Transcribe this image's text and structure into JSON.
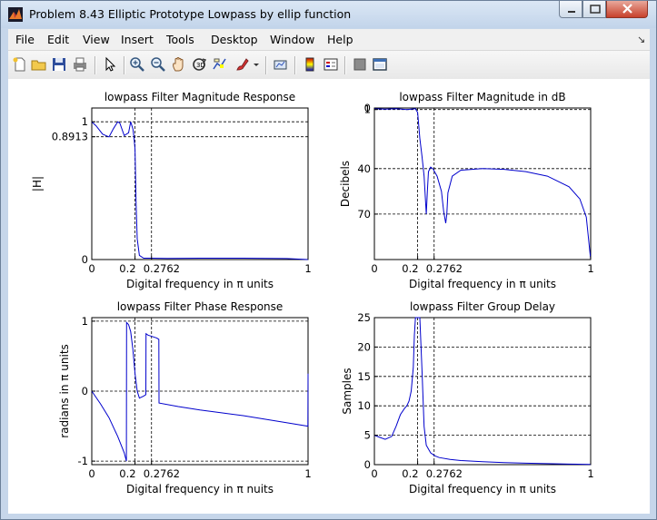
{
  "window": {
    "title": "Problem 8.43 Elliptic Prototype Lowpass by ellip function",
    "icon": "matlab-figure-icon"
  },
  "menu": [
    "File",
    "Edit",
    "View",
    "Insert",
    "Tools",
    "Desktop",
    "Window",
    "Help"
  ],
  "toolbar": [
    "new-figure-icon",
    "open-file-icon",
    "save-icon",
    "print-icon",
    "pointer-icon",
    "zoom-in-icon",
    "zoom-out-icon",
    "pan-icon",
    "rotate-3d-icon",
    "data-cursor-icon",
    "brush-icon",
    "link-plot-icon",
    "colorbar-icon",
    "legend-icon",
    "hide-plot-tools-icon",
    "show-plot-tools-icon"
  ],
  "colors": {
    "plot_line": "#0000cc",
    "axes": "#000000",
    "grid": "#000000",
    "window_frame": "#c6d6ea"
  },
  "chart_data": [
    {
      "type": "line",
      "title": "lowpass Filter Magnitude Response",
      "xlabel": "Digital frequency in π units",
      "ylabel": "|H|",
      "xlim": [
        0,
        1
      ],
      "ylim": [
        0,
        1.1
      ],
      "x_ticks": [
        "0",
        "0.2",
        "0.2762",
        "1"
      ],
      "x_tick_values": [
        0,
        0.2,
        0.2762,
        1
      ],
      "y_ticks": [
        "0",
        "0.8913",
        "1"
      ],
      "y_tick_values": [
        0,
        0.8913,
        1
      ],
      "grid": "dashed at ticks",
      "series": [
        {
          "x": [
            0,
            0.02,
            0.05,
            0.08,
            0.1,
            0.12,
            0.13,
            0.15,
            0.17,
            0.18,
            0.19,
            0.195,
            0.2,
            0.205,
            0.21,
            0.22,
            0.24,
            0.2762,
            0.35,
            0.5,
            0.7,
            0.9,
            1
          ],
          "y": [
            1,
            0.97,
            0.91,
            0.89,
            0.95,
            1,
            0.99,
            0.9,
            0.92,
            1,
            0.95,
            0.89,
            0.8,
            0.4,
            0.15,
            0.03,
            0.01,
            0.01,
            0.008,
            0.01,
            0.01,
            0.007,
            0.0
          ]
        }
      ]
    },
    {
      "type": "line",
      "title": "lowpass Filter Magnitude in dB",
      "xlabel": "Digital frequency in π units",
      "ylabel": "Decibels",
      "xlim": [
        0,
        1
      ],
      "ylim": [
        -100,
        0
      ],
      "y_reversed_labels": true,
      "x_ticks": [
        "0",
        "0.2",
        "0.2762",
        "1"
      ],
      "x_tick_values": [
        0,
        0.2,
        0.2762,
        1
      ],
      "y_ticks": [
        "1",
        "0",
        "40",
        "70"
      ],
      "y_tick_values": [
        -1,
        0,
        -40,
        -70
      ],
      "grid": "dashed at ticks",
      "series": [
        {
          "x": [
            0,
            0.05,
            0.1,
            0.15,
            0.19,
            0.2,
            0.21,
            0.22,
            0.23,
            0.24,
            0.245,
            0.25,
            0.26,
            0.27,
            0.29,
            0.31,
            0.32,
            0.33,
            0.335,
            0.34,
            0.36,
            0.4,
            0.5,
            0.6,
            0.7,
            0.8,
            0.9,
            0.95,
            0.98,
            1
          ],
          "y": [
            -0.5,
            -0.8,
            -0.5,
            -1.0,
            -0.5,
            -3,
            -20,
            -32,
            -45,
            -70,
            -55,
            -42,
            -39,
            -40,
            -45,
            -55,
            -68,
            -76,
            -70,
            -56,
            -45,
            -41,
            -40,
            -40.5,
            -42,
            -45,
            -52,
            -60,
            -72,
            -100
          ]
        }
      ]
    },
    {
      "type": "line",
      "title": "lowpass Filter Phase Response",
      "xlabel": "Digital frequency in π nuits",
      "ylabel": "radians in π units",
      "xlim": [
        0,
        1
      ],
      "ylim": [
        -1.05,
        1.05
      ],
      "x_ticks": [
        "0",
        "0.2",
        "0.2762",
        "1"
      ],
      "x_tick_values": [
        0,
        0.2,
        0.2762,
        1
      ],
      "y_ticks": [
        "-1",
        "0",
        "1"
      ],
      "y_tick_values": [
        -1,
        0,
        1
      ],
      "grid": "dashed at ticks",
      "series": [
        {
          "x": [
            0,
            0.04,
            0.08,
            0.12,
            0.15,
            0.16,
            0.161,
            0.17,
            0.18,
            0.19,
            0.2,
            0.21,
            0.22,
            0.24,
            0.25,
            0.251,
            0.26,
            0.28,
            0.3,
            0.31,
            0.311,
            0.4,
            0.5,
            0.6,
            0.7,
            0.8,
            0.9,
            0.999,
            1
          ],
          "y": [
            0,
            -0.18,
            -0.38,
            -0.65,
            -0.88,
            -1.0,
            0.98,
            0.95,
            0.85,
            0.6,
            0.25,
            0.0,
            -0.1,
            -0.07,
            -0.05,
            0.82,
            0.8,
            0.78,
            0.76,
            0.74,
            -0.17,
            -0.22,
            -0.27,
            -0.31,
            -0.35,
            -0.4,
            -0.45,
            -0.5,
            0.25
          ]
        }
      ]
    },
    {
      "type": "line",
      "title": "lowpass Filter Group Delay",
      "xlabel": "Digital frequency in π units",
      "ylabel": "Samples",
      "xlim": [
        0,
        1
      ],
      "ylim": [
        0,
        25
      ],
      "x_ticks": [
        "0",
        "0.2",
        "0.2762",
        "1"
      ],
      "x_tick_values": [
        0,
        0.2,
        0.2762,
        1
      ],
      "y_ticks": [
        "0",
        "5",
        "10",
        "15",
        "20",
        "25"
      ],
      "y_tick_values": [
        0,
        5,
        10,
        15,
        20,
        25
      ],
      "grid": "dashed at ticks",
      "series": [
        {
          "x": [
            0,
            0.02,
            0.05,
            0.08,
            0.1,
            0.12,
            0.14,
            0.15,
            0.16,
            0.17,
            0.18,
            0.185,
            0.19,
            0.2,
            0.21,
            0.22,
            0.23,
            0.24,
            0.26,
            0.28,
            0.3,
            0.35,
            0.4,
            0.5,
            0.6,
            0.7,
            0.8,
            0.9,
            1
          ],
          "y": [
            5,
            4.7,
            4.3,
            4.8,
            6.5,
            8.5,
            9.6,
            10.0,
            10.8,
            12.5,
            16.5,
            22,
            25,
            25,
            25,
            16,
            6.5,
            3.3,
            2.0,
            1.5,
            1.2,
            0.9,
            0.7,
            0.5,
            0.35,
            0.25,
            0.17,
            0.1,
            0.05
          ]
        }
      ]
    }
  ]
}
